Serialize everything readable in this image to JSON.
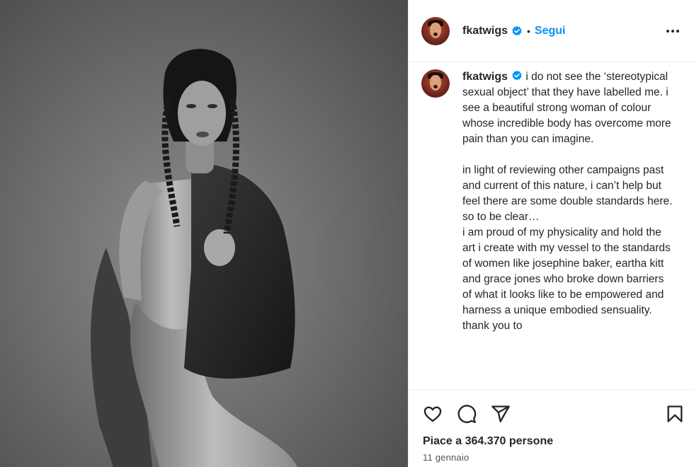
{
  "post": {
    "username": "fkatwigs",
    "follow_label": "Segui",
    "separator": "•",
    "caption": "i do not see the ‘stereotypical sexual object’ that they have labelled me. i see a beautiful strong woman of colour whose incredible body has overcome more pain than you can imagine.\n\nin light of reviewing other campaigns past and current of this nature, i can’t help but feel there are some double standards here. so to be clear…\ni am proud of my physicality and hold the art i create with my vessel to the standards of women like josephine baker, eartha kitt and grace jones who broke down barriers of what it looks like to be empowered and harness a unique embodied sensuality. thank you to",
    "likes": "Piace a 364.370 persone",
    "date": "11 gennaio"
  },
  "icons": {
    "verified": "verified-badge-icon",
    "more": "more-options-icon",
    "like": "heart-icon",
    "comment": "comment-icon",
    "share": "paper-plane-icon",
    "save": "bookmark-icon"
  },
  "colors": {
    "accent": "#0095f6",
    "text": "#262626",
    "border": "#efefef"
  }
}
